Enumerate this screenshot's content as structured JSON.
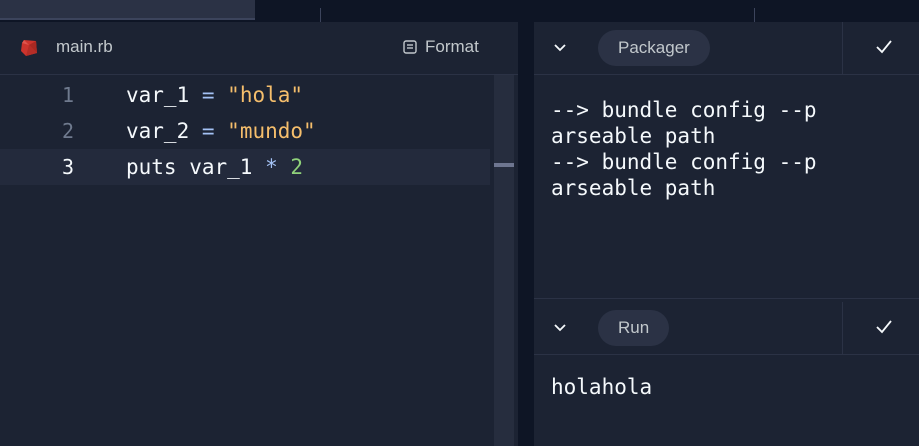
{
  "editor": {
    "file_name": "main.rb",
    "format_label": "Format",
    "file_icon": "ruby-gem-icon",
    "format_icon": "format-doc-icon",
    "lines": [
      {
        "number": "1",
        "tokens": [
          {
            "t": "var_1 ",
            "k": "plain"
          },
          {
            "t": "=",
            "k": "op"
          },
          {
            "t": " ",
            "k": "plain"
          },
          {
            "t": "\"hola\"",
            "k": "str"
          }
        ]
      },
      {
        "number": "2",
        "tokens": [
          {
            "t": "var_2 ",
            "k": "plain"
          },
          {
            "t": "=",
            "k": "op"
          },
          {
            "t": " ",
            "k": "plain"
          },
          {
            "t": "\"mundo\"",
            "k": "str"
          }
        ]
      },
      {
        "number": "3",
        "tokens": [
          {
            "t": "puts var_1 ",
            "k": "plain"
          },
          {
            "t": "*",
            "k": "op"
          },
          {
            "t": " ",
            "k": "plain"
          },
          {
            "t": "2",
            "k": "num"
          }
        ]
      }
    ],
    "active_line": 3
  },
  "packager": {
    "title": "Packager",
    "output_lines": [
      "--> bundle config --p",
      "arseable path",
      "--> bundle config --p",
      "arseable path"
    ]
  },
  "run": {
    "title": "Run",
    "output_lines": [
      "holahola"
    ]
  },
  "colors": {
    "background": "#1c2333",
    "string": "#f5be6c",
    "operator": "#a4c2f5",
    "number": "#8fd17a",
    "ruby": "#cc342d"
  }
}
